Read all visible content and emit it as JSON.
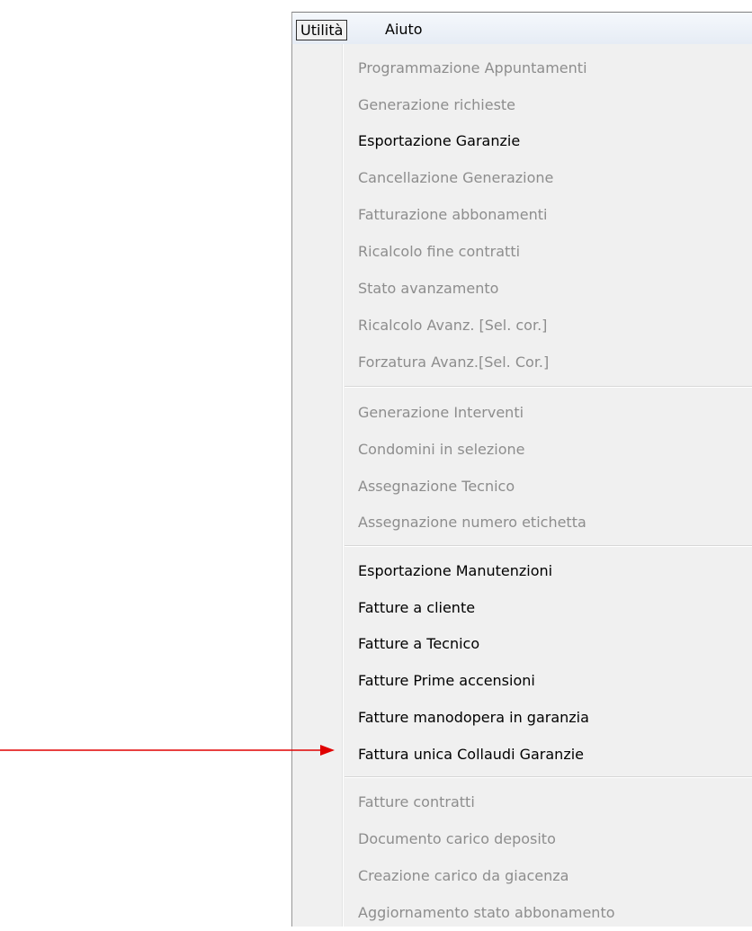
{
  "menubar": {
    "items": [
      "Utilità",
      "Aiuto"
    ]
  },
  "menu": {
    "group1": [
      {
        "label": "Programmazione Appuntamenti",
        "enabled": false
      },
      {
        "label": "Generazione richieste",
        "enabled": false
      },
      {
        "label": "Esportazione Garanzie",
        "enabled": true
      },
      {
        "label": "Cancellazione Generazione",
        "enabled": false
      },
      {
        "label": "Fatturazione abbonamenti",
        "enabled": false
      },
      {
        "label": "Ricalcolo fine contratti",
        "enabled": false
      },
      {
        "label": "Stato avanzamento",
        "enabled": false
      },
      {
        "label": "Ricalcolo Avanz. [Sel. cor.]",
        "enabled": false
      },
      {
        "label": "Forzatura Avanz.[Sel. Cor.]",
        "enabled": false
      }
    ],
    "group2": [
      {
        "label": "Generazione Interventi",
        "enabled": false
      },
      {
        "label": "Condomini in selezione",
        "enabled": false
      },
      {
        "label": "Assegnazione Tecnico",
        "enabled": false
      },
      {
        "label": "Assegnazione numero etichetta",
        "enabled": false
      }
    ],
    "group3": [
      {
        "label": "Esportazione Manutenzioni",
        "enabled": true
      },
      {
        "label": "Fatture a cliente",
        "enabled": true
      },
      {
        "label": "Fatture a Tecnico",
        "enabled": true
      },
      {
        "label": "Fatture Prime accensioni",
        "enabled": true
      },
      {
        "label": "Fatture manodopera in garanzia",
        "enabled": true
      },
      {
        "label": "Fattura unica Collaudi Garanzie",
        "enabled": true
      }
    ],
    "group4": [
      {
        "label": "Fatture contratti",
        "enabled": false
      },
      {
        "label": "Documento carico deposito",
        "enabled": false
      },
      {
        "label": "Creazione carico da giacenza",
        "enabled": false
      },
      {
        "label": "Aggiornamento stato abbonamento",
        "enabled": false
      }
    ]
  },
  "colors": {
    "enabled_text": "#000000",
    "disabled_text": "#8d8d8d",
    "menu_background": "#f0f0f0",
    "annotation_arrow": "#e00000"
  },
  "annotation": {
    "icon": "red-arrow-icon",
    "points_to": "Fattura unica Collaudi Garanzie"
  }
}
